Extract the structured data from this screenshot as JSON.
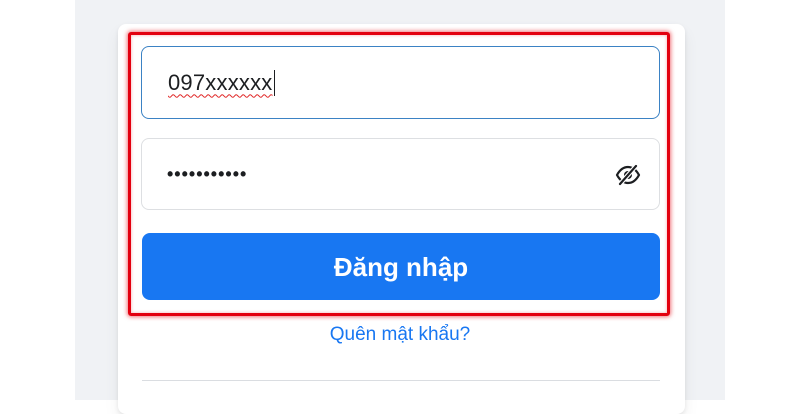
{
  "login_form": {
    "phone_field": {
      "value": "097xxxxxx"
    },
    "password_field": {
      "masked_value": "•••••••••••",
      "toggle_icon": "eye-slash-icon"
    },
    "login_button_label": "Đăng nhập",
    "forgot_password_label": "Quên mật khẩu?"
  },
  "colors": {
    "accent": "#1877f2",
    "highlight": "#e3000f",
    "page_background": "#f0f2f5"
  }
}
